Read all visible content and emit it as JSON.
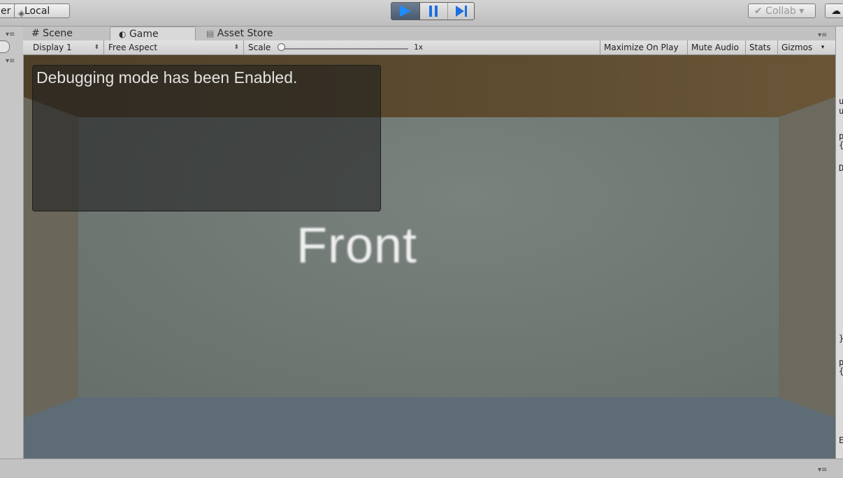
{
  "toolbar": {
    "pivot_label": "er",
    "local_label": "Local",
    "collab_label": "✔ Collab ▾",
    "cloud_label": "☁"
  },
  "tabs": {
    "scene": "# Scene",
    "game": "Game",
    "asset_store": "Asset Store"
  },
  "game_toolbar": {
    "display": "Display 1",
    "aspect": "Free Aspect",
    "scale_label": "Scale",
    "scale_value": "1x",
    "scale_level": 0.0,
    "maximize": "Maximize On Play",
    "mute": "Mute Audio",
    "stats": "Stats",
    "gizmos": "Gizmos"
  },
  "game_view": {
    "debug_message": "Debugging mode has been Enabled.",
    "front_label": "Front"
  },
  "right_panel": {
    "fragments": [
      "u",
      "u",
      "p",
      "{",
      "D",
      "}",
      "p",
      "{",
      "E"
    ]
  },
  "colors": {
    "play_accent": "#1e8bff",
    "ceiling": "#5a4a2e",
    "wall": "#6e7672",
    "floor": "#5d6b74"
  }
}
